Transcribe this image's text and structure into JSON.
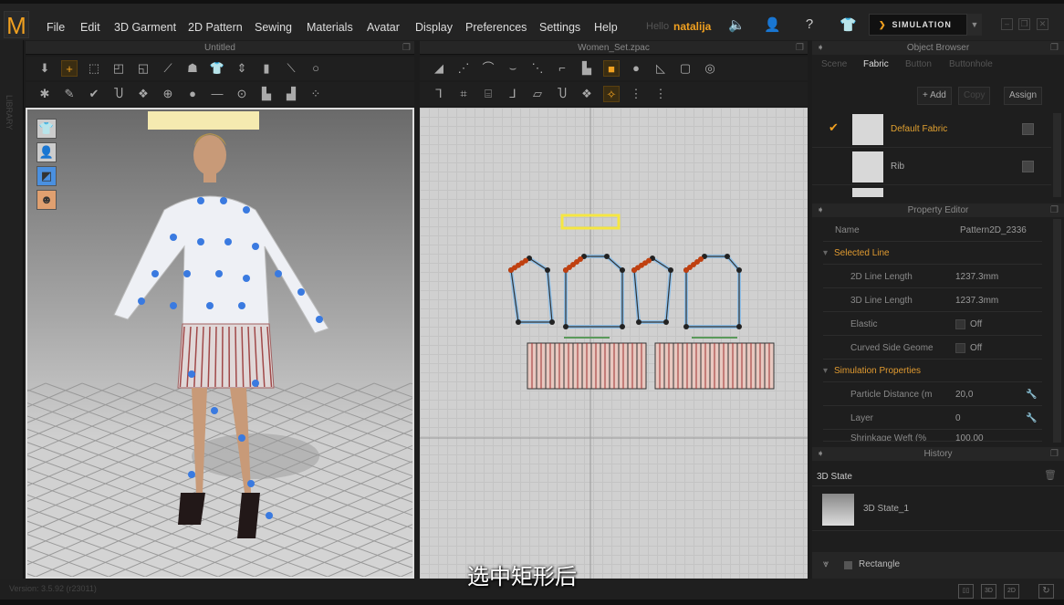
{
  "app": {
    "logo": "M",
    "hello": "Hello",
    "user": "natalija",
    "simulation": "SIMULATION",
    "version": "Version: 3.5.92   (r23011)"
  },
  "menu": [
    "File",
    "Edit",
    "3D Garment",
    "2D Pattern",
    "Sewing",
    "Materials",
    "Avatar",
    "Display",
    "Preferences",
    "Settings",
    "Help"
  ],
  "library_label": "LIBRARY",
  "panels": {
    "viewport3d_title": "Untitled",
    "viewport2d_title": "Women_Set.zpac"
  },
  "object_browser": {
    "title": "Object Browser",
    "tabs": [
      "Scene",
      "Fabric",
      "Button",
      "Buttonhole"
    ],
    "active_tab": "Fabric",
    "buttons": {
      "add": "+ Add",
      "copy": "Copy",
      "assign": "Assign"
    },
    "fabrics": [
      {
        "name": "Default Fabric",
        "selected": true
      },
      {
        "name": "Rib",
        "selected": false
      }
    ]
  },
  "property_editor": {
    "title": "Property Editor",
    "name_label": "Name",
    "name_value": "Pattern2D_2336",
    "sections": [
      {
        "title": "Selected Line",
        "rows": [
          {
            "label": "2D Line Length",
            "value": "1237.3mm"
          },
          {
            "label": "3D Line Length",
            "value": "1237.3mm"
          },
          {
            "label": "Elastic",
            "value": "Off",
            "checkbox": true
          },
          {
            "label": "Curved Side Geome",
            "value": "Off",
            "checkbox": true
          }
        ]
      },
      {
        "title": "Simulation Properties",
        "rows": [
          {
            "label": "Particle Distance (m",
            "value": "20,0"
          },
          {
            "label": "Layer",
            "value": "0"
          },
          {
            "label": "Shrinkage Weft (%",
            "value": "100,00"
          }
        ]
      }
    ]
  },
  "history": {
    "title": "History",
    "section": "3D State",
    "items": [
      "3D State_1"
    ]
  },
  "bottom_panel": {
    "label": "Rectangle"
  },
  "subtitle": "选中矩形后",
  "colors": {
    "accent": "#f0a020",
    "background": "#1c1c1c",
    "selection": "#f5e642",
    "pattern_outline": "#90c0e8",
    "seam_points": "#c04010"
  }
}
